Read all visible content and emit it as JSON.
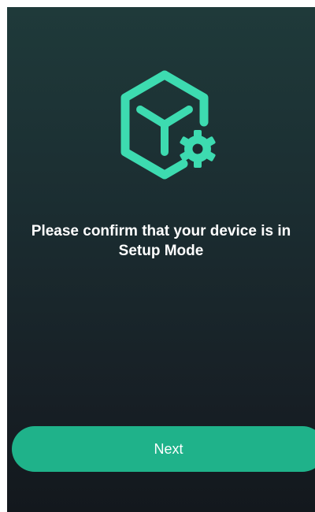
{
  "screen": {
    "icon": "device-box-with-gear-icon",
    "accent_color": "#3ddbb0",
    "background_top": "#1f3a3a",
    "background_bottom": "#13181d",
    "message": "Please confirm that your device is in Setup Mode"
  },
  "footer": {
    "next_label": "Next",
    "button_color": "#1fb28a"
  }
}
